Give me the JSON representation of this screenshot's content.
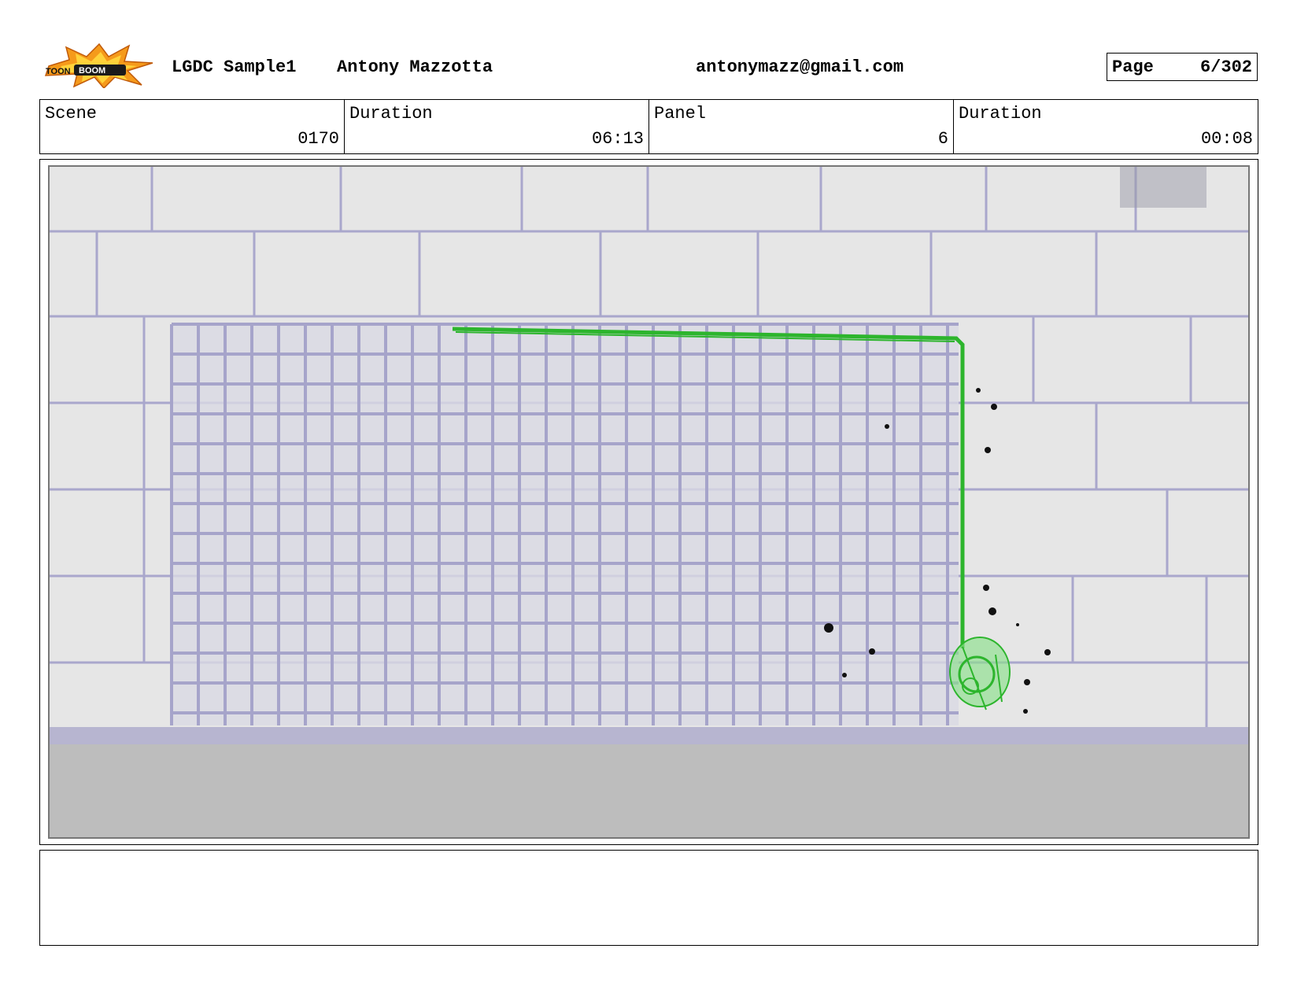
{
  "header": {
    "logo_text_1": "TOON",
    "logo_text_2": "BOOM",
    "project": "LGDC Sample1",
    "author": "Antony Mazzotta",
    "email": "antonymazz@gmail.com",
    "page_label": "Page",
    "page_value": "6/302"
  },
  "info": {
    "scene_label": "Scene",
    "scene_value": "0170",
    "scene_duration_label": "Duration",
    "scene_duration_value": "06:13",
    "panel_label": "Panel",
    "panel_value": "6",
    "panel_duration_label": "Duration",
    "panel_duration_value": "00:08"
  },
  "colors": {
    "sketch_green": "#2db52d",
    "wall_lines": "#a9a7cc",
    "grate": "#a6a4ca",
    "floor": "#bdbdbd",
    "logo_orange": "#f59a1b"
  },
  "notes": ""
}
